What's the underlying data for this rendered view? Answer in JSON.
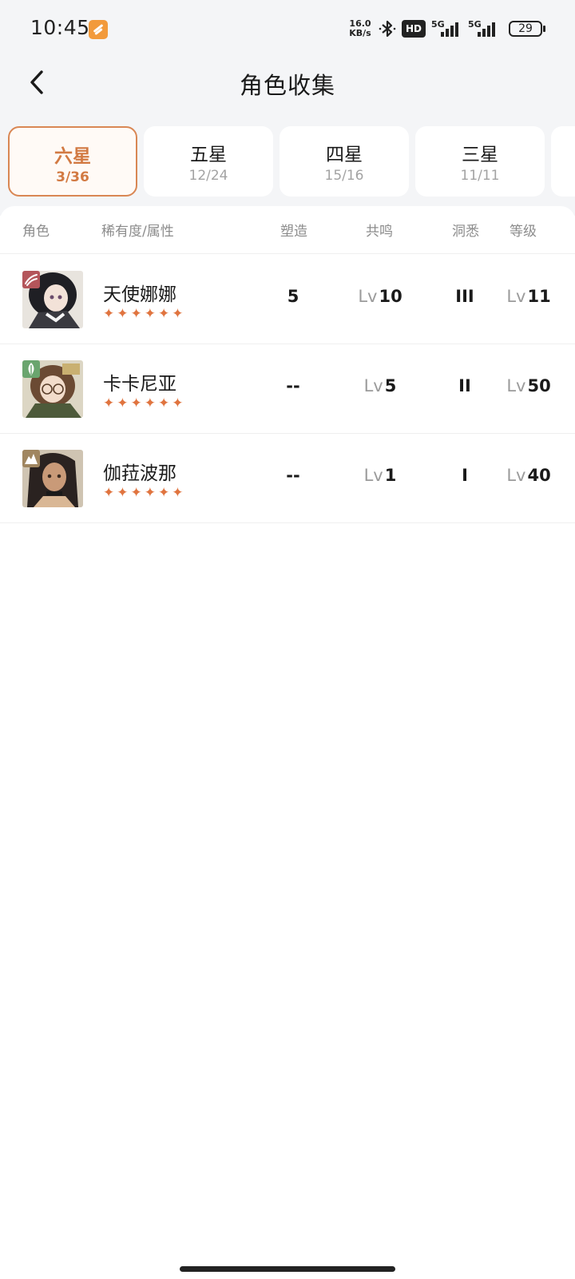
{
  "status_bar": {
    "time": "10:45",
    "net_speed_value": "16.0",
    "net_speed_unit": "KB/s",
    "hd_label": "HD",
    "signal_1_label": "5G",
    "signal_2_label": "5G",
    "battery": "29",
    "icons": [
      "app-notification-icon",
      "bluetooth-icon",
      "hd-voice-icon",
      "signal-icon",
      "battery-icon"
    ]
  },
  "header": {
    "title": "角色收集",
    "back_icon": "chevron-left-icon"
  },
  "tabs": [
    {
      "label": "六星",
      "count": "3/36",
      "active": true
    },
    {
      "label": "五星",
      "count": "12/24",
      "active": false
    },
    {
      "label": "四星",
      "count": "15/16",
      "active": false
    },
    {
      "label": "三星",
      "count": "11/11",
      "active": false
    }
  ],
  "columns": {
    "character": "角色",
    "rarity_attr": "稀有度/属性",
    "shaping": "塑造",
    "resonance": "共鸣",
    "insight": "洞悉",
    "level": "等级"
  },
  "lv_prefix": "Lv",
  "rows": [
    {
      "name": "天使娜娜",
      "stars": "✦✦✦✦✦✦",
      "element_icon": "wave-element-icon",
      "element_color": "#b4555a",
      "shaping": "5",
      "resonance": "10",
      "insight": "III",
      "level": "11"
    },
    {
      "name": "卡卡尼亚",
      "stars": "✦✦✦✦✦✦",
      "element_icon": "leaf-element-icon",
      "element_color": "#6aa56e",
      "shaping": "--",
      "resonance": "5",
      "insight": "II",
      "level": "50"
    },
    {
      "name": "伽菈波那",
      "stars": "✦✦✦✦✦✦",
      "element_icon": "rock-element-icon",
      "element_color": "#a08660",
      "shaping": "--",
      "resonance": "1",
      "insight": "I",
      "level": "40"
    }
  ],
  "colors": {
    "accent": "#d27a43",
    "star": "#e0743f",
    "background": "#f4f5f7"
  }
}
